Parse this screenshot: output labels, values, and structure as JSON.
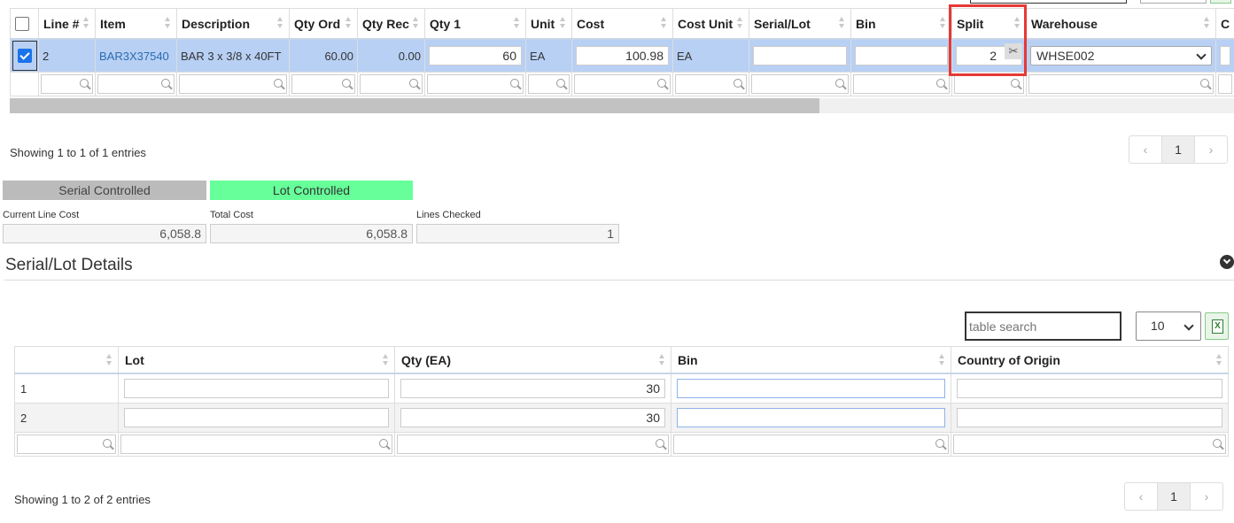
{
  "line_table": {
    "headers": [
      "Line #",
      "Item",
      "Description",
      "Qty Ord",
      "Qty Rec",
      "Qty 1",
      "Unit",
      "Cost",
      "Cost Unit",
      "Serial/Lot",
      "Bin",
      "Split",
      "Warehouse",
      "C"
    ],
    "row": {
      "line": "2",
      "item": "BAR3X37540",
      "description": "BAR 3 x 3/8 x 40FT",
      "qty_ord": "60.00",
      "qty_rec": "0.00",
      "qty1": "60",
      "unit": "EA",
      "cost": "100.98",
      "cost_unit": "EA",
      "serial_lot": "",
      "bin": "",
      "split": "2",
      "warehouse": "WHSE002"
    },
    "info": "Showing 1 to 1 of 1 entries",
    "page": "1",
    "prev": "‹",
    "next": "›"
  },
  "controls": {
    "serial_controlled": "Serial Controlled",
    "lot_controlled": "Lot Controlled",
    "current_line_cost_label": "Current Line Cost",
    "current_line_cost": "6,058.8",
    "total_cost_label": "Total Cost",
    "total_cost": "6,058.8",
    "lines_checked_label": "Lines Checked",
    "lines_checked": "1"
  },
  "details": {
    "title": "Serial/Lot Details",
    "search_placeholder": "table search",
    "page_size": "10",
    "headers": [
      "",
      "Lot",
      "Qty (EA)",
      "Bin",
      "Country of Origin"
    ],
    "rows": [
      {
        "n": "1",
        "lot": "",
        "qty": "30",
        "bin": "",
        "country": ""
      },
      {
        "n": "2",
        "lot": "",
        "qty": "30",
        "bin": "",
        "country": ""
      }
    ],
    "info": "Showing 1 to 2 of 2 entries",
    "page": "1",
    "prev": "‹",
    "next": "›"
  },
  "colors": {
    "selected_row": "#b8d0f4",
    "lot_controlled": "#66ff99",
    "serial_controlled": "#bbbbbb",
    "highlight_box": "#e53935"
  },
  "icons": [
    "search-icon",
    "scissors-icon",
    "chevron-down-icon",
    "excel-icon",
    "checkbox-icon"
  ]
}
